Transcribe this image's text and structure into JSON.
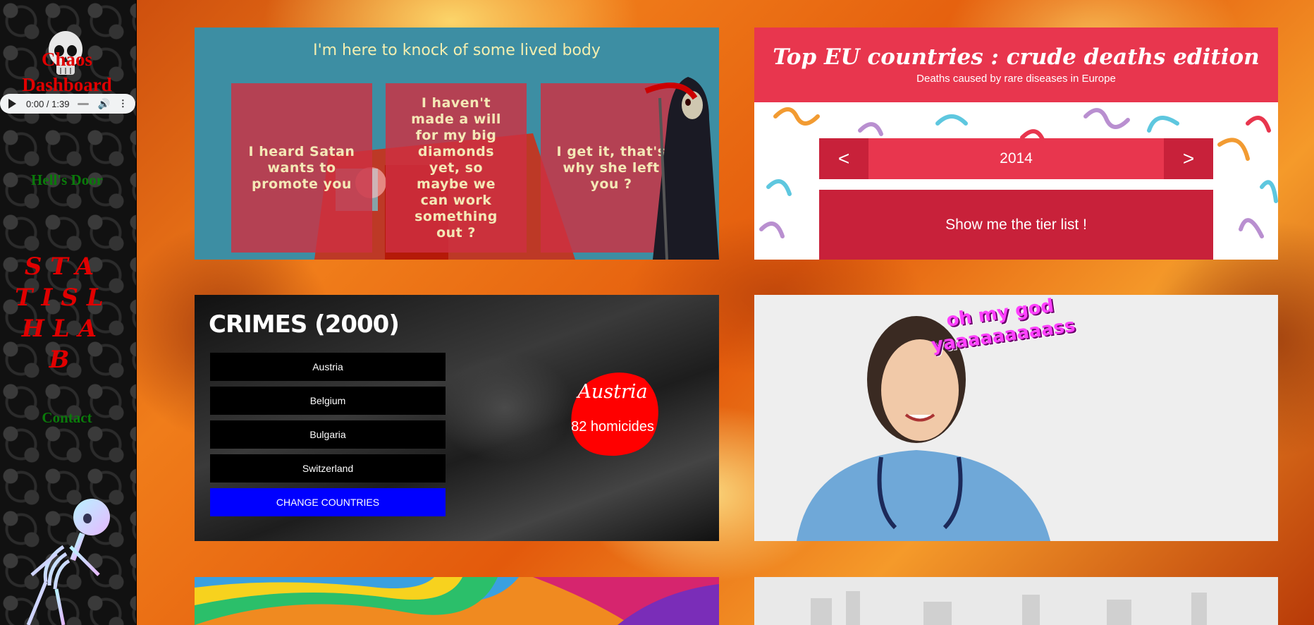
{
  "sidebar": {
    "title": "Chaos Dashboard",
    "audio": {
      "time": "0:00 / 1:39"
    },
    "nav": {
      "hells_door": "Hell's Door",
      "stats": "STATISLHLAB",
      "contact": "Contact"
    }
  },
  "card_satan": {
    "title": "I'm here to knock of some lived body",
    "tiles": [
      "I heard Satan wants to promote you",
      "I haven't made a will for my big diamonds yet, so maybe we can work something out ?",
      "I get it, that's why she left you ?"
    ]
  },
  "card_deaths": {
    "title": "Top EU countries : crude deaths edition",
    "subtitle": "Deaths caused by rare diseases in Europe",
    "prev_label": "<",
    "next_label": ">",
    "year": "2014",
    "tier_button": "Show me the tier list !"
  },
  "card_crimes": {
    "title": "CRIMES (2000)",
    "countries": [
      "Austria",
      "Belgium",
      "Bulgaria",
      "Switzerland"
    ],
    "change_button": "CHANGE COUNTRIES",
    "highlight_country": "Austria",
    "highlight_count": "82 homicides",
    "accent": "#0000ff",
    "blob_color": "#ff0000"
  },
  "card_meme": {
    "line1": "oh my god",
    "line2": "yaaaaaaaaass"
  },
  "colors": {
    "brand_red": "#e8364e",
    "tier_red": "#c8213a",
    "nav_green": "#0a7a0a",
    "title_red": "#e00000"
  }
}
